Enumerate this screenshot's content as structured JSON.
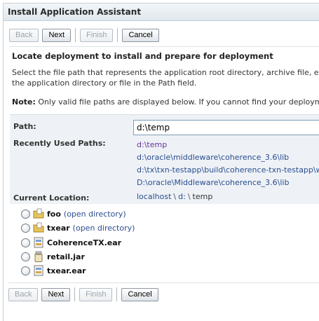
{
  "window": {
    "title": "Install Application Assistant"
  },
  "top_buttons": {
    "back": "Back",
    "next": "Next",
    "finish": "Finish",
    "cancel": "Cancel"
  },
  "bottom_buttons": {
    "back": "Back",
    "next": "Next",
    "finish": "Finish",
    "cancel": "Cancel"
  },
  "content": {
    "heading": "Locate deployment to install and prepare for deployment",
    "description_line1": "Select the file path that represents the application root directory, archive file, exploded ar",
    "description_line2": "the application directory or file in the Path field.",
    "note_label": "Note:",
    "note_text": " Only valid file paths are displayed below. If you cannot find your deployment files, u"
  },
  "form": {
    "path_label": "Path:",
    "path_value": "d:\\temp",
    "recent_label": "Recently Used Paths:",
    "recent_paths": [
      "d:\\temp",
      "d:\\oracle\\middleware\\coherence_3.6\\lib",
      "d:\\tx\\txn-testapp\\build\\coherence-txn-testapp\\wls",
      "D:\\oracle\\Middleware\\coherence_3.6\\lib"
    ],
    "current_label": "Current Location:",
    "location": {
      "host": "localhost",
      "sep1": "\\",
      "drive": "d:",
      "sep2": "\\",
      "folder": "temp"
    }
  },
  "files": [
    {
      "name": "foo",
      "link": "(open directory)",
      "icon": "folder-icon"
    },
    {
      "name": "txear",
      "link": "(open directory)",
      "icon": "folder-icon"
    },
    {
      "name": "CoherenceTX.ear",
      "link": "",
      "icon": "ear-archive-icon"
    },
    {
      "name": "retail.jar",
      "link": "",
      "icon": "jar-archive-icon"
    },
    {
      "name": "txear.ear",
      "link": "",
      "icon": "ear-archive-icon"
    }
  ]
}
